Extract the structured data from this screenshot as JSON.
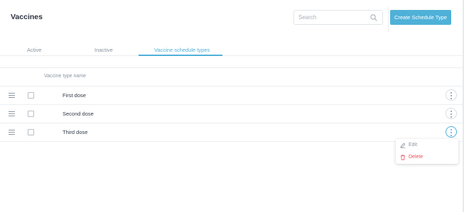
{
  "page": {
    "title": "Vaccines"
  },
  "search": {
    "placeholder": "Search",
    "value": ""
  },
  "actions": {
    "create_label": "Create Schedule Type"
  },
  "tabs": [
    {
      "label": "Active",
      "active": false
    },
    {
      "label": "Inactive",
      "active": false
    },
    {
      "label": "Vaccine schedule types",
      "active": true
    }
  ],
  "table": {
    "column_header": "Vaccine type name",
    "rows": [
      {
        "name": "First dose"
      },
      {
        "name": "Second dose"
      },
      {
        "name": "Third dose"
      }
    ]
  },
  "row_menu": {
    "items": [
      {
        "label": "Edit",
        "icon": "pencil-icon"
      },
      {
        "label": "Delete",
        "icon": "trash-icon"
      }
    ]
  },
  "colors": {
    "accent": "#4fb1d8",
    "danger": "#e8505b"
  }
}
